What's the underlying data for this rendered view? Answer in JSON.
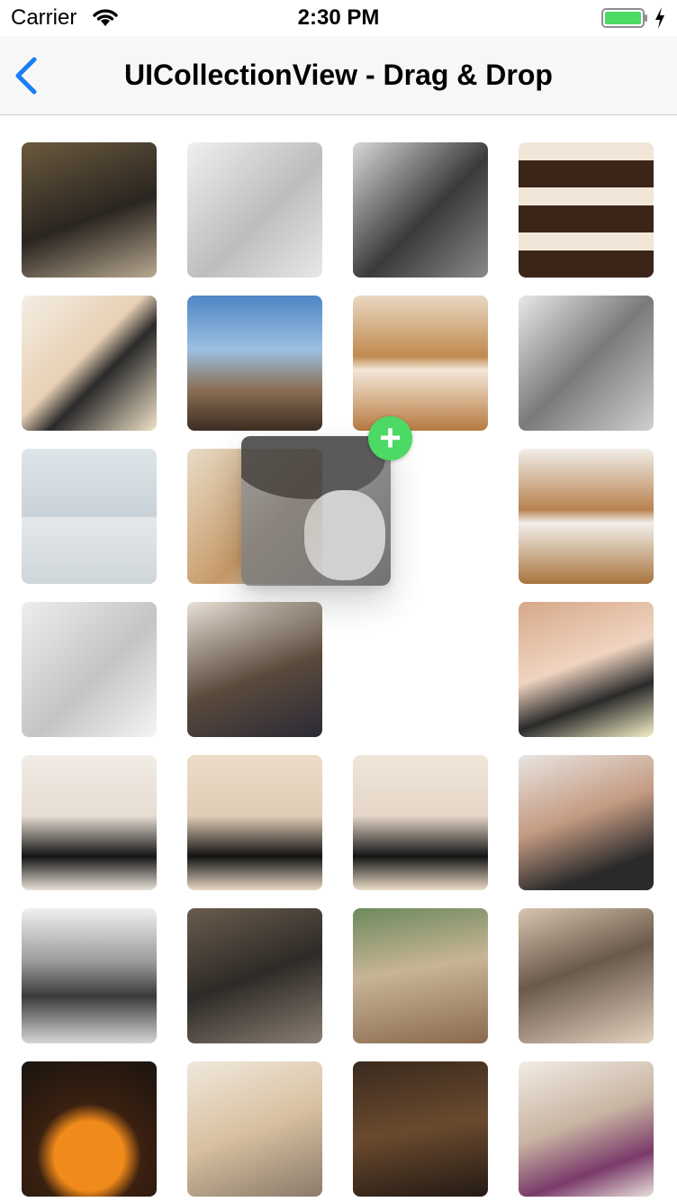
{
  "status_bar": {
    "carrier": "Carrier",
    "time": "2:30 PM"
  },
  "nav": {
    "title": "UICollectionView - Drag & Drop",
    "back_icon": "chevron-left-icon",
    "accent": "#1a7ef5"
  },
  "photos": [
    {
      "desc": "dark-outfit-room",
      "bg": "linear-gradient(160deg,#6b5a3e,#2a2520 55%,#b8a890)"
    },
    {
      "desc": "faded-grey-portrait",
      "bg": "linear-gradient(135deg,#f0f0f0,#bdbdbd 55%,#e8e8e8)"
    },
    {
      "desc": "bw-cap-portrait",
      "bg": "linear-gradient(135deg,#d8d8d8,#3a3a3a 55%,#8a8a8a)"
    },
    {
      "desc": "triple-strip-warm",
      "bg": "repeating-linear-gradient(180deg,#f2e6d8 0 20px,#3b2418 20px 50px)"
    },
    {
      "desc": "cap-warm-blur",
      "bg": "linear-gradient(135deg,#f4eee4,#e8d0b4 45%,#2a2a2a 60%,#f0e2c8)"
    },
    {
      "desc": "city-sky",
      "bg": "linear-gradient(180deg,#4f86c6 0%,#9cc0e0 40%,#8a6e54 70%,#3c2d22)"
    },
    {
      "desc": "double-warm-lying",
      "bg": "linear-gradient(180deg,#e9d8c2 0%,#c08a4e 45%,#f3e7d8 55%,#b77a3f)"
    },
    {
      "desc": "grey-lean",
      "bg": "linear-gradient(135deg,#e8e8e8,#7a7a7a 50%,#cfcfcf)"
    },
    {
      "desc": "pale-double",
      "bg": "linear-gradient(180deg,#dfe6ea 0%,#c9d2d8 50%,#e4e8ea 51%,#cfd6da)"
    },
    {
      "desc": "warm-interior",
      "bg": "linear-gradient(135deg,#e8dcc6,#c89a6a 60%,#f5ead8)"
    },
    {
      "desc": "(dragging)",
      "bg": "transparent"
    },
    {
      "desc": "double-bed-warm",
      "bg": "linear-gradient(180deg,#f0ede8 0%,#b98350 45%,#f2efea 55%,#a9743f)"
    },
    {
      "desc": "pale-bw-face",
      "bg": "linear-gradient(135deg,#eeeeee,#c4c4c4 55%,#f4f4f4)"
    },
    {
      "desc": "trophy-selfie",
      "bg": "linear-gradient(160deg,#e8e0d6,#5a4a3c 55%,#2c2a36)"
    },
    {
      "desc": "(empty)",
      "bg": "transparent"
    },
    {
      "desc": "lying-closeup",
      "bg": "linear-gradient(160deg,#d6a88a,#f0d4c0 45%,#2a2a2a 70%,#f6f0c8)"
    },
    {
      "desc": "tissot-event-1",
      "bg": "linear-gradient(180deg,#f2ece6 0%,#e6ddd2 45%,#151515 75%,#e8e0d6)"
    },
    {
      "desc": "tissot-event-2",
      "bg": "linear-gradient(180deg,#ecdcc8 0%,#e0cdb6 45%,#121212 75%,#e8d8c4)"
    },
    {
      "desc": "tissot-event-3",
      "bg": "linear-gradient(180deg,#f0e6da 0%,#e4d6c6 45%,#141414 75%,#ecdcc8)"
    },
    {
      "desc": "portrait-lace",
      "bg": "linear-gradient(160deg,#e8e4e0,#c49a82 45%,#2a2a2a 80%)"
    },
    {
      "desc": "sofa-bw",
      "bg": "linear-gradient(180deg,#f0f0f0 0%,#9a9a9a 40%,#3a3a3a 65%,#d6d6d6)"
    },
    {
      "desc": "street-walk",
      "bg": "linear-gradient(160deg,#6a5c4e,#2e2a26 50%,#8a7e72)"
    },
    {
      "desc": "cat-table",
      "bg": "linear-gradient(170deg,#6c8a5c,#c8b496 45%,#8a6a4e)"
    },
    {
      "desc": "teddy-bear",
      "bg": "linear-gradient(160deg,#d8c4b0,#6a5a4a 45%,#e4d2c0)"
    },
    {
      "desc": "pumpkin-night",
      "bg": "radial-gradient(circle at 50% 70%,#f08a1a 0 30%,#3a2010 45%,#1a1410)"
    },
    {
      "desc": "bow-wink",
      "bg": "linear-gradient(160deg,#f0e8dc,#d8c0a0 50%,#8a7a6a)"
    },
    {
      "desc": "hall-coat",
      "bg": "linear-gradient(170deg,#3a2a1e,#6a4a2e 50%,#241a14)"
    },
    {
      "desc": "vogue-flower",
      "bg": "linear-gradient(160deg,#f2ece4,#c8b4a2 45%,#7a3a6a 75%,#e8e0d8)"
    }
  ]
}
